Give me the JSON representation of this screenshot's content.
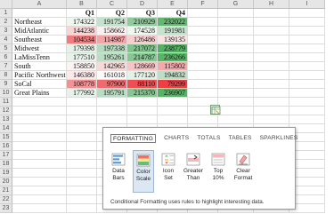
{
  "sheet": {
    "columns": [
      "A",
      "B",
      "C",
      "D",
      "E",
      "F",
      "G",
      "H",
      "I"
    ],
    "rows": [
      "1",
      "2",
      "3",
      "4",
      "5",
      "6",
      "7",
      "8",
      "9",
      "10",
      "11",
      "12",
      "13",
      "14",
      "15",
      "16",
      "17",
      "18",
      "19",
      "20",
      "21",
      "22",
      "23"
    ],
    "header": [
      "",
      "Q1",
      "Q2",
      "Q3",
      "Q4"
    ],
    "data": [
      [
        "Northeast",
        "174322",
        "191754",
        "210929",
        "232022"
      ],
      [
        "MidAtlantic",
        "144238",
        "158662",
        "174528",
        "191981"
      ],
      [
        "Southeast",
        "104534",
        "114987",
        "126486",
        "139135"
      ],
      [
        "Midwest",
        "179398",
        "197338",
        "217072",
        "238779"
      ],
      [
        "LaMissTenn",
        "177510",
        "195261",
        "214787",
        "236266"
      ],
      [
        "South",
        "158850",
        "142965",
        "128669",
        "115802"
      ],
      [
        "Pacific Northwest",
        "146380",
        "161018",
        "177120",
        "194832"
      ],
      [
        "SoCal",
        "108778",
        "97900",
        "88110",
        "79299"
      ],
      [
        "Great Plains",
        "177992",
        "195791",
        "215370",
        "236907"
      ]
    ],
    "fill_colors": [
      [
        "#ffffff",
        "#eef7f0",
        "#c4e2cc",
        "#8fca9c",
        "#63b76f"
      ],
      [
        "#ffffff",
        "#f8d4d5",
        "#fcf1f1",
        "#eef7f0",
        "#c6e3cd"
      ],
      [
        "#ffffff",
        "#f27b7f",
        "#f5a3a6",
        "#f8cfd1",
        "#fae3e4"
      ],
      [
        "#ffffff",
        "#e4f2e8",
        "#b5dbbe",
        "#7fc48d",
        "#52b162"
      ],
      [
        "#ffffff",
        "#e8f4eb",
        "#bbdec4",
        "#86c793",
        "#58b467"
      ],
      [
        "#ffffff",
        "#fcf3f3",
        "#f8d9da",
        "#f7c3c5",
        "#f5a8ab"
      ],
      [
        "#ffffff",
        "#fce9ea",
        "#fdfafa",
        "#e3f2e7",
        "#bcdec4"
      ],
      [
        "#ffffff",
        "#f39195",
        "#f1696e",
        "#f04e53",
        "#ef3e44"
      ],
      [
        "#ffffff",
        "#e6f3ea",
        "#b9ddc2",
        "#84c792",
        "#56b366"
      ]
    ]
  },
  "quick_analysis": {
    "tabs": [
      "FORMATTING",
      "CHARTS",
      "TOTALS",
      "TABLES",
      "SPARKLINES"
    ],
    "items": [
      {
        "line1": "Data",
        "line2": "Bars",
        "icon": "data-bars-icon"
      },
      {
        "line1": "Color",
        "line2": "Scale",
        "icon": "color-scale-icon"
      },
      {
        "line1": "Icon",
        "line2": "Set",
        "icon": "icon-set-icon"
      },
      {
        "line1": "Greater",
        "line2": "Than",
        "icon": "greater-than-icon"
      },
      {
        "line1": "Top",
        "line2": "10%",
        "icon": "top-10-icon"
      },
      {
        "line1": "Clear",
        "line2": "Format",
        "icon": "clear-format-icon"
      }
    ],
    "status": "Conditional Formatting uses rules to highlight interesting data.",
    "accent": "#9db6d2"
  }
}
